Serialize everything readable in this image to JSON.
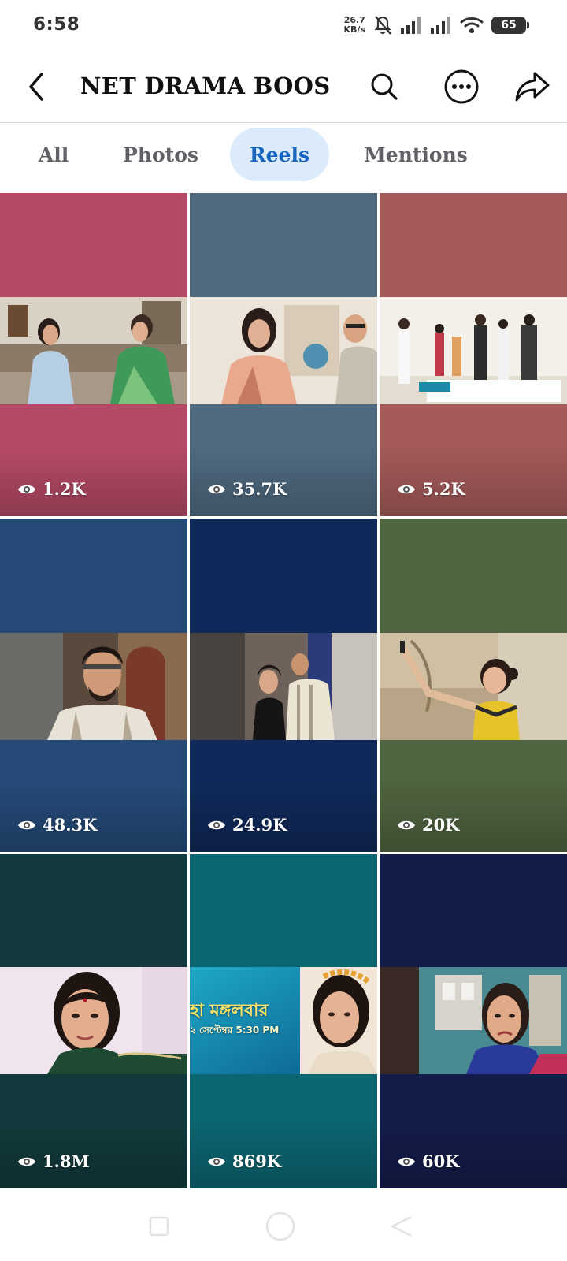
{
  "status_bar": {
    "time": "6:58",
    "net_speed_value": "26.7",
    "net_speed_unit": "KB/s",
    "battery": "65",
    "icons": [
      "notifications-muted-icon",
      "signal-icon",
      "signal-icon",
      "wifi-icon",
      "battery-icon"
    ]
  },
  "header": {
    "title": "NET DRAMA BOOS",
    "icons": [
      "back-arrow-icon",
      "search-icon",
      "more-options-icon",
      "share-icon"
    ]
  },
  "tabs": [
    {
      "label": "All",
      "selected": false
    },
    {
      "label": "Photos",
      "selected": false
    },
    {
      "label": "Reels",
      "selected": true
    },
    {
      "label": "Mentions",
      "selected": false
    }
  ],
  "colors": {
    "accent": "#1565c0",
    "selected_tab_bg": "#dcebfb"
  },
  "reels": [
    {
      "views": "1.2K",
      "bg": "#b54a66",
      "scene": "two women seated in a living room"
    },
    {
      "views": "35.7K",
      "bg": "#506a80",
      "scene": "woman in saree and man with glasses"
    },
    {
      "views": "5.2K",
      "bg": "#a65a5a",
      "scene": "family gathering in a hall"
    },
    {
      "views": "48.3K",
      "bg": "#254a78",
      "scene": "man with glasses and beard"
    },
    {
      "views": "24.9K",
      "bg": "#10295a",
      "scene": "couple talking in a corridor"
    },
    {
      "views": "20K",
      "bg": "#4f6440",
      "scene": "little girl raising her hand"
    },
    {
      "views": "1.8M",
      "bg": "#123a3c",
      "scene": "woman with a thoughtful expression"
    },
    {
      "views": "869K",
      "bg": "#0b6672",
      "scene": "promo with bangla caption"
    },
    {
      "views": "60K",
      "bg": "#141c4a",
      "scene": "woman crying in a room"
    }
  ],
  "promo": {
    "line1": "হা মঙ্গলবার",
    "line2": "২ সেপ্টেম্বর 5:30 PM"
  },
  "navbar": {
    "icons": [
      "recent-apps-icon",
      "home-icon",
      "back-icon"
    ]
  }
}
